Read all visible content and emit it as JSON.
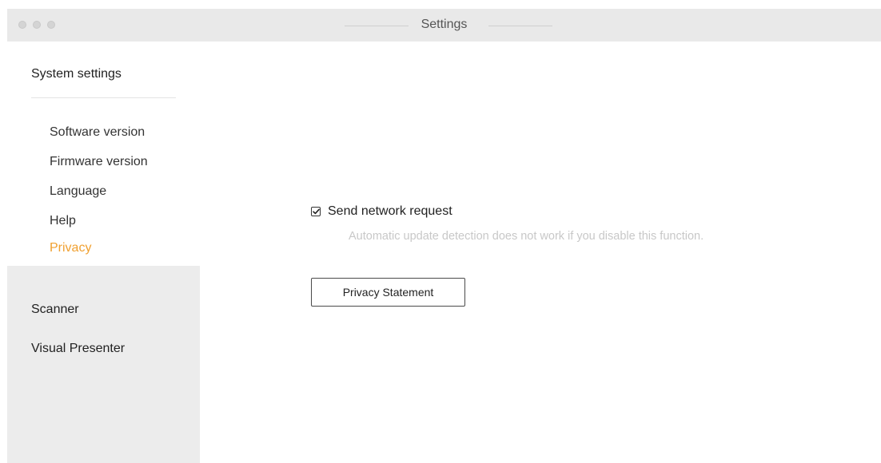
{
  "window": {
    "title": "Settings"
  },
  "sidebar": {
    "group_title": "System settings",
    "sub_items": [
      {
        "label": "Software version",
        "active": false
      },
      {
        "label": "Firmware version",
        "active": false
      },
      {
        "label": "Language",
        "active": false
      },
      {
        "label": "Help",
        "active": false
      },
      {
        "label": "Privacy",
        "active": true
      }
    ],
    "top_items": [
      {
        "label": "Scanner"
      },
      {
        "label": "Visual Presenter"
      }
    ]
  },
  "privacy": {
    "network_request": {
      "label": "Send network request",
      "checked": true,
      "hint": "Automatic update detection does not work if you disable this function."
    },
    "statement_button_label": "Privacy Statement"
  },
  "colors": {
    "accent": "#f0a030",
    "titlebar_bg": "#e9e9e9",
    "sidebar_bg": "#ececec",
    "hint_text": "#c8c8c8"
  },
  "icons": {
    "checkbox": "checkmark-icon",
    "traffic_lights": [
      "close-icon",
      "minimize-icon",
      "zoom-icon"
    ]
  }
}
